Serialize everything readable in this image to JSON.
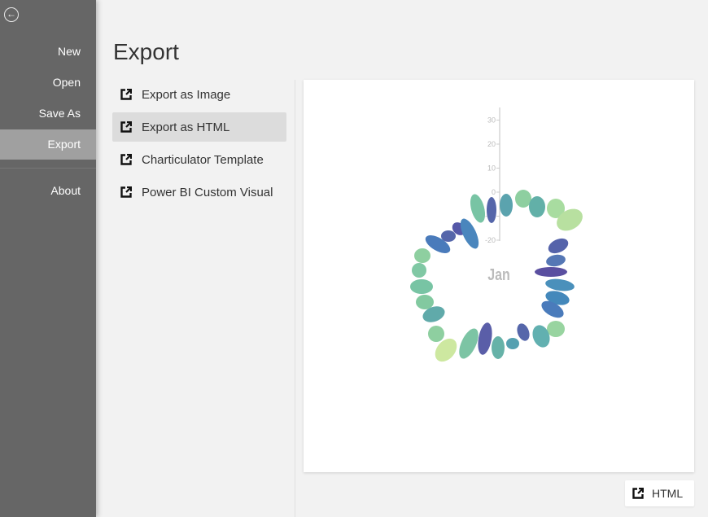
{
  "sidebar": {
    "back_icon": "arrow-left-circle-icon",
    "items": [
      {
        "label": "New"
      },
      {
        "label": "Open"
      },
      {
        "label": "Save As"
      },
      {
        "label": "Export",
        "active": true
      },
      {
        "label": "About"
      }
    ]
  },
  "main": {
    "title": "Export",
    "options": [
      {
        "label": "Export as Image",
        "icon": "external-link-icon"
      },
      {
        "label": "Export as HTML",
        "icon": "external-link-icon",
        "selected": true
      },
      {
        "label": "Charticulator Template",
        "icon": "external-link-icon"
      },
      {
        "label": "Power BI Custom Visual",
        "icon": "external-link-icon"
      }
    ],
    "export_button": {
      "label": "HTML",
      "icon": "external-link-icon"
    }
  },
  "chart_data": {
    "type": "radial-glyph",
    "center_label": "Jan",
    "y_axis": {
      "ticks": [
        30,
        20,
        10,
        0,
        -10,
        -20
      ],
      "range": [
        -20,
        35
      ]
    },
    "mark_count": 31,
    "palette": [
      "#5566aa",
      "#4a86bd",
      "#5ba3ae",
      "#78c4a4",
      "#a8dca0",
      "#cde8a0"
    ]
  }
}
